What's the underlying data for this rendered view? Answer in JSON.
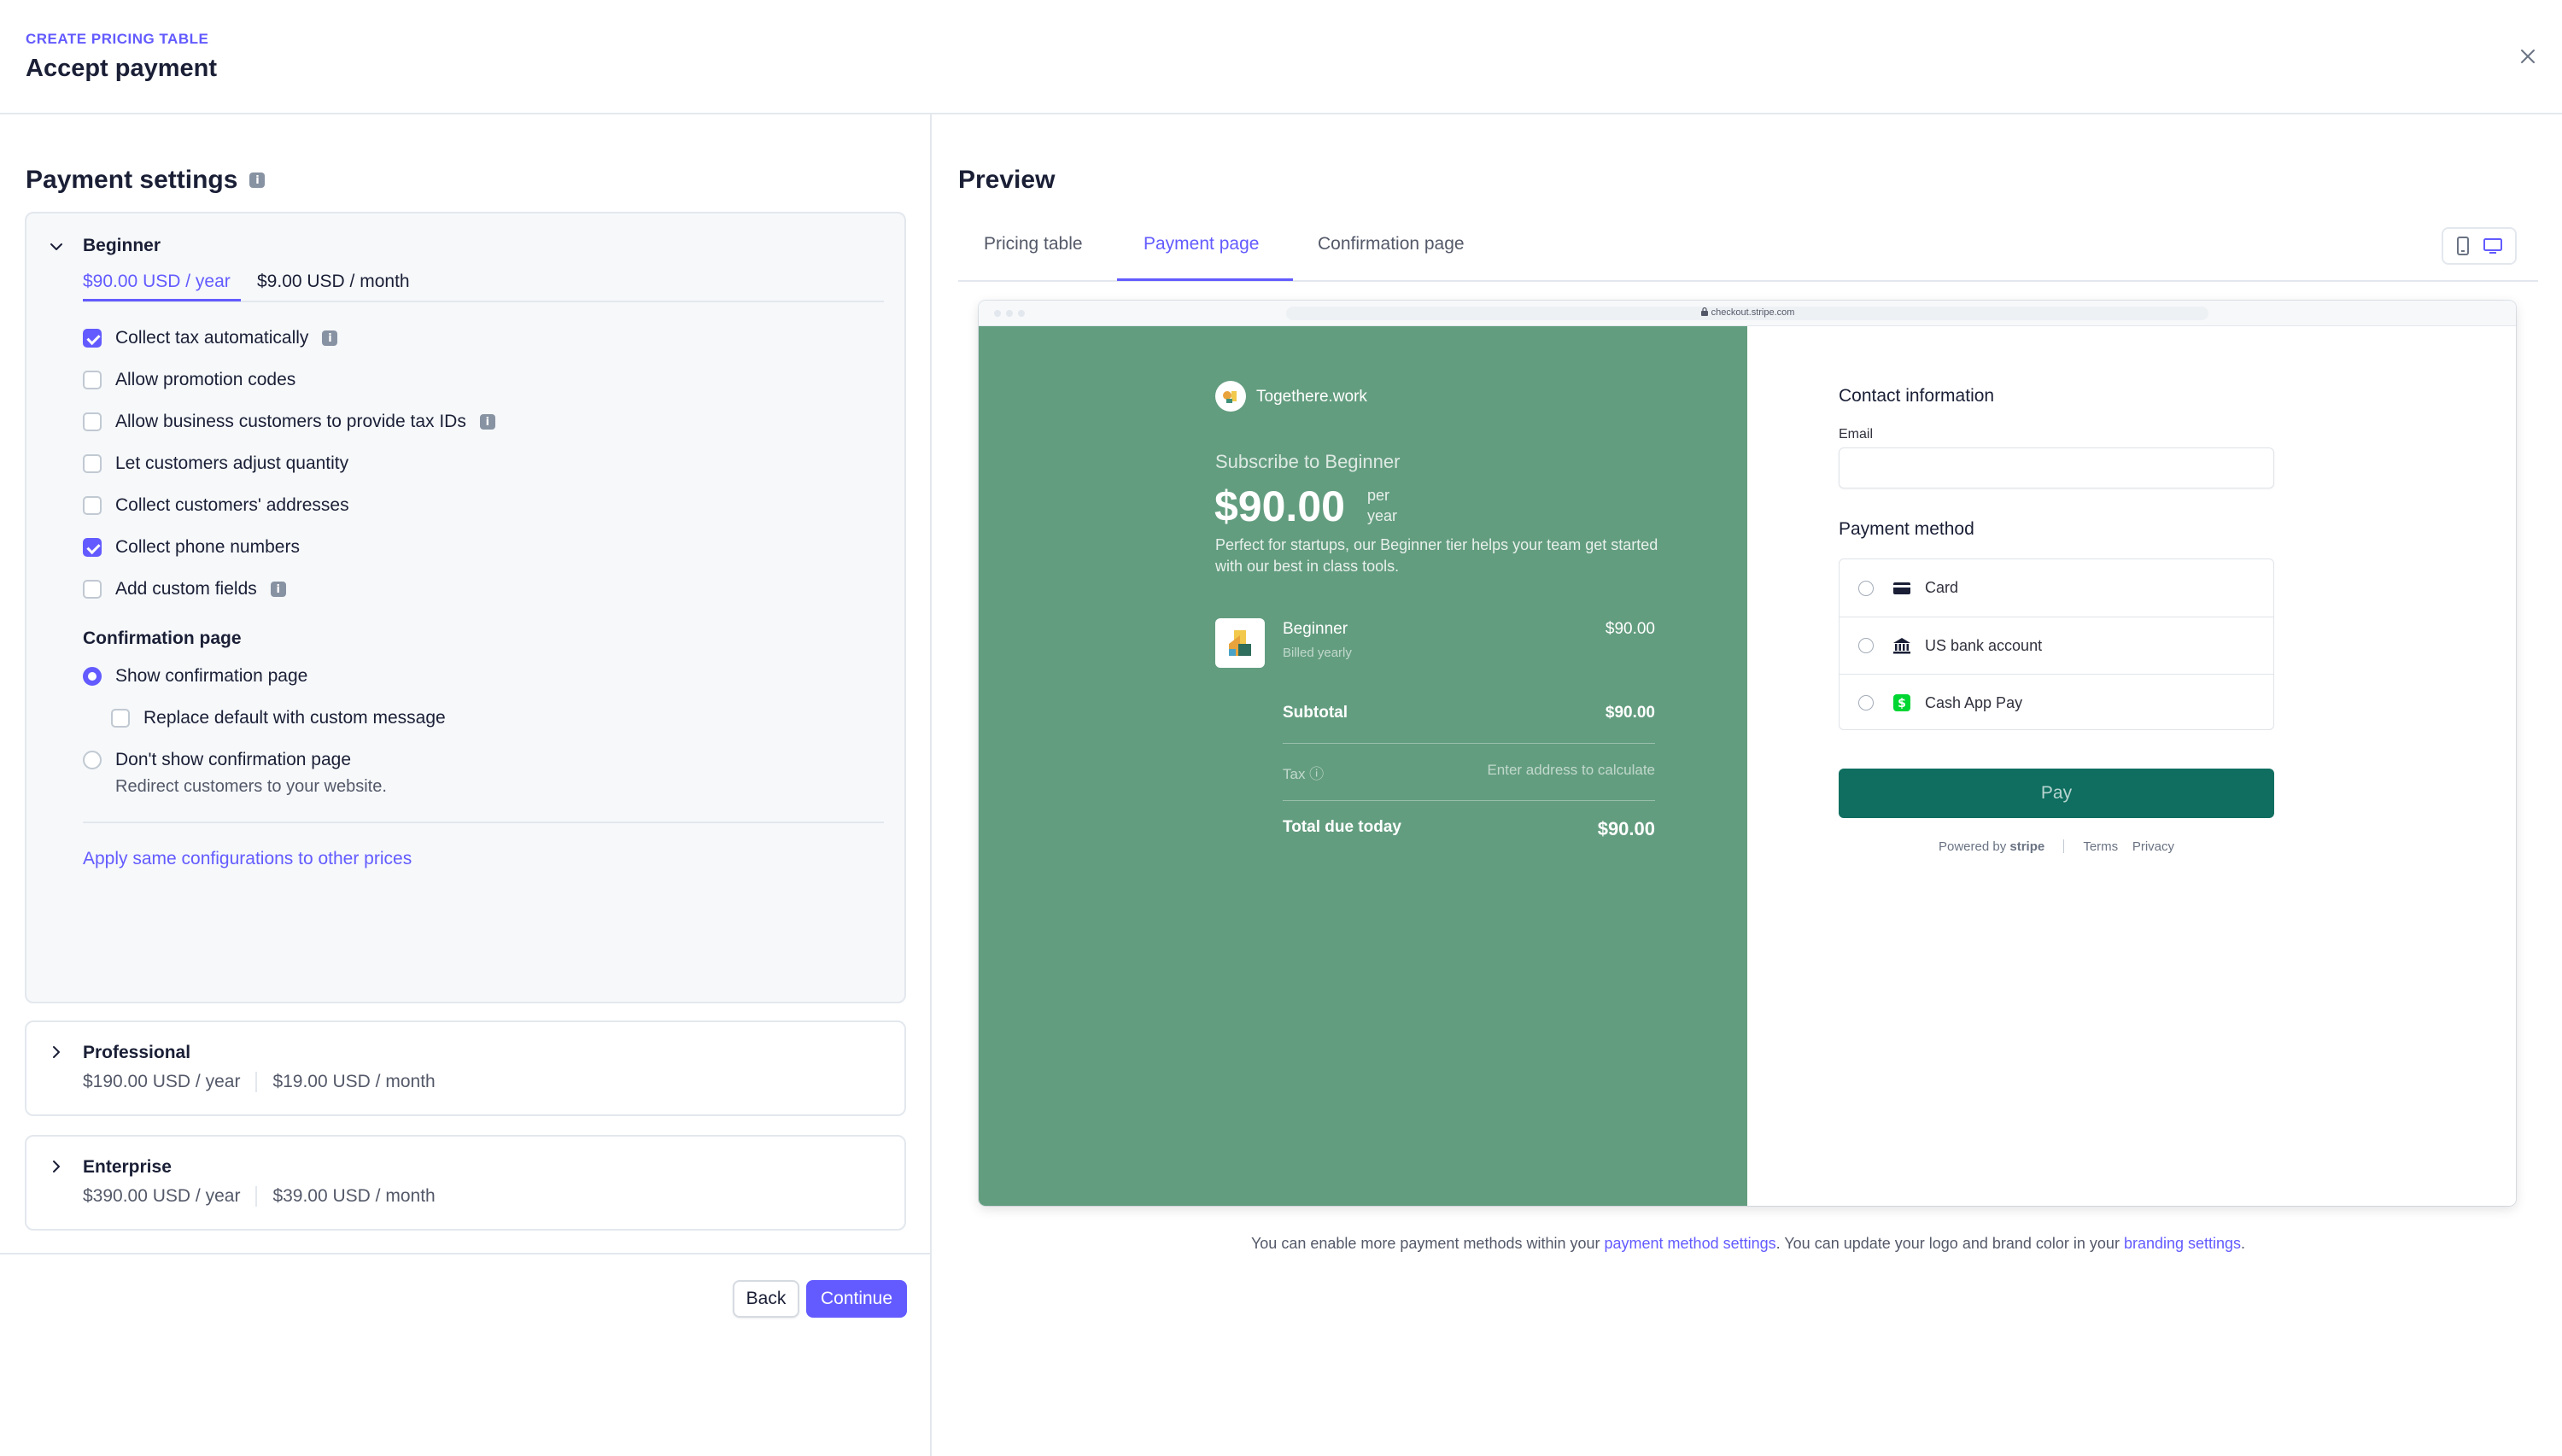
{
  "header": {
    "eyebrow": "CREATE PRICING TABLE",
    "title": "Accept payment"
  },
  "payment_settings": {
    "title": "Payment settings",
    "beginner": {
      "name": "Beginner",
      "price_yearly": "$90.00 USD / year",
      "price_monthly": "$9.00 USD / month",
      "options": [
        {
          "label": "Collect tax automatically",
          "checked": true
        },
        {
          "label": "Allow promotion codes",
          "checked": false
        },
        {
          "label": "Allow business customers to provide tax IDs",
          "checked": false
        },
        {
          "label": "Let customers adjust quantity",
          "checked": false
        },
        {
          "label": "Collect customers' addresses",
          "checked": false
        },
        {
          "label": "Collect phone numbers",
          "checked": true
        },
        {
          "label": "Add custom fields",
          "checked": false
        }
      ],
      "confirmation": {
        "heading": "Confirmation page",
        "show_label": "Show confirmation page",
        "replace_label": "Replace default with custom message",
        "dont_show_label": "Don't show confirmation page",
        "dont_show_sub": "Redirect customers to your website.",
        "selected": "show"
      },
      "apply_link": "Apply same configurations to other prices"
    },
    "professional": {
      "name": "Professional",
      "price_yearly": "$190.00 USD / year",
      "price_monthly": "$19.00 USD / month"
    },
    "enterprise": {
      "name": "Enterprise",
      "price_yearly": "$390.00 USD / year",
      "price_monthly": "$39.00 USD / month"
    }
  },
  "footer": {
    "back_label": "Back",
    "continue_label": "Continue"
  },
  "preview": {
    "title": "Preview",
    "tabs": [
      "Pricing table",
      "Payment page",
      "Confirmation page"
    ],
    "active_tab": "Payment page",
    "url": "checkout.stripe.com",
    "checkout": {
      "brand": "Togethere.work",
      "subscribe": "Subscribe to Beginner",
      "price": "$90.00",
      "per": "per",
      "period": "year",
      "description": "Perfect for startups, our Beginner tier helps your team get started with our best in class tools.",
      "item_name": "Beginner",
      "item_sub": "Billed yearly",
      "item_amount": "$90.00",
      "subtotal_label": "Subtotal",
      "subtotal_amount": "$90.00",
      "tax_label": "Tax ⓘ",
      "tax_value": "Enter address to calculate",
      "total_label": "Total due today",
      "total_amount": "$90.00",
      "accent_color": "#639d7f"
    },
    "form": {
      "contact_title": "Contact information",
      "email_label": "Email",
      "email_value": "",
      "payment_method_title": "Payment method",
      "methods": [
        {
          "label": "Card",
          "icon": "card-icon"
        },
        {
          "label": "US bank account",
          "icon": "bank-icon"
        },
        {
          "label": "Cash App Pay",
          "icon": "cash-app-icon"
        }
      ],
      "pay_label": "Pay",
      "powered_by": "Powered by",
      "stripe": "stripe",
      "terms": "Terms",
      "privacy": "Privacy"
    },
    "note": {
      "part1": "You can enable more payment methods within your ",
      "link1": "payment method settings",
      "part2": ". You can update your logo and brand color in your ",
      "link2": "branding settings",
      "part3": "."
    }
  },
  "colors": {
    "accent": "#635bff",
    "pay_button": "#0f6e60"
  }
}
